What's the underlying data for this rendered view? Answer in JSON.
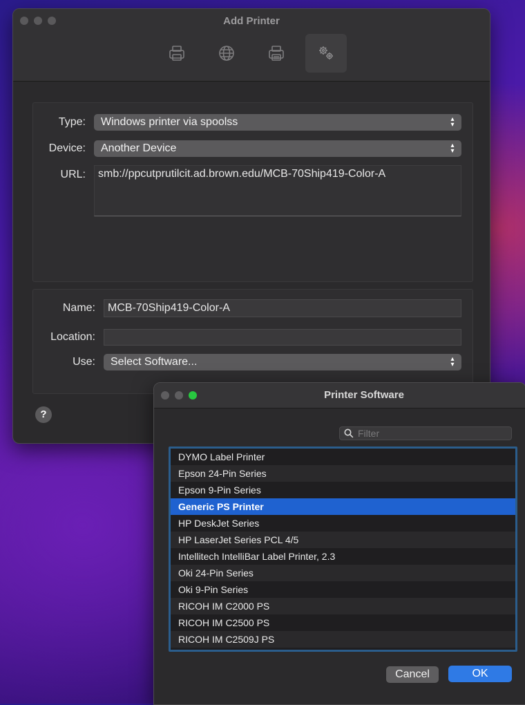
{
  "main_window": {
    "title": "Add Printer",
    "toolbar": [
      "default-printer-icon",
      "ip-globe-icon",
      "windows-printer-icon",
      "advanced-gears-icon"
    ],
    "type_label": "Type:",
    "type_value": "Windows printer via spoolss",
    "device_label": "Device:",
    "device_value": "Another Device",
    "url_label": "URL:",
    "url_value": "smb://ppcutprutilcit.ad.brown.edu/MCB-70Ship419-Color-A",
    "name_label": "Name:",
    "name_value": "MCB-70Ship419-Color-A",
    "location_label": "Location:",
    "location_value": "",
    "use_label": "Use:",
    "use_value": "Select Software...",
    "help": "?"
  },
  "sheet": {
    "title": "Printer Software",
    "filter_placeholder": "Filter",
    "items": [
      "DYMO Label Printer",
      "Epson 24-Pin Series",
      "Epson 9-Pin Series",
      "Generic PS Printer",
      "HP DeskJet Series",
      "HP LaserJet Series PCL 4/5",
      "Intellitech IntelliBar Label Printer, 2.3",
      "Oki 24-Pin Series",
      "Oki 9-Pin Series",
      "RICOH IM C2000 PS",
      "RICOH IM C2500 PS",
      "RICOH IM C2509J PS"
    ],
    "selected_index": 3,
    "cancel_label": "Cancel",
    "ok_label": "OK"
  },
  "colors": {
    "accent": "#2f7ae5",
    "selection": "#1f62d0",
    "close_light": "#ff5f57",
    "min_light": "#febc2e",
    "zoom_light": "#28c840"
  }
}
